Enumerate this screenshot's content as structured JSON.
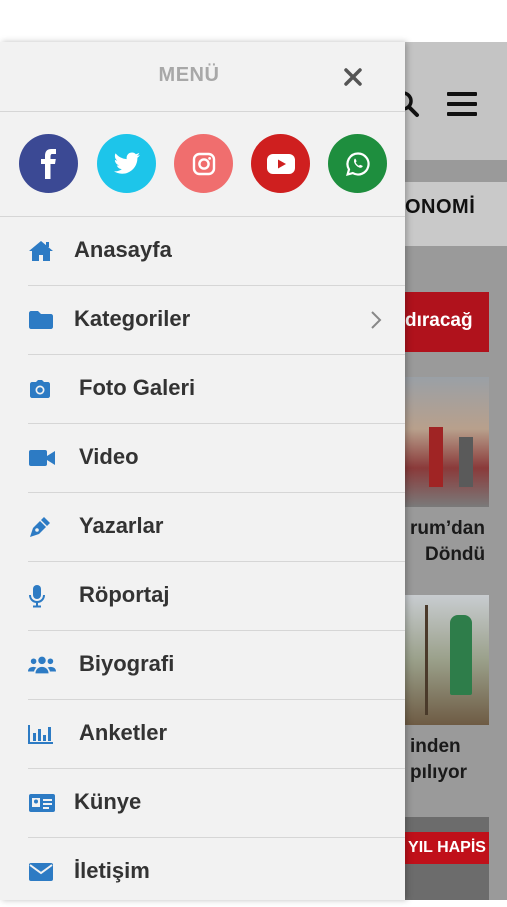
{
  "drawer": {
    "title": "MENÜ",
    "close_icon": "close-icon",
    "social": [
      {
        "name": "facebook",
        "icon": "facebook-icon",
        "color": "#3b4994"
      },
      {
        "name": "twitter",
        "icon": "twitter-icon",
        "color": "#1dc5ea"
      },
      {
        "name": "instagram",
        "icon": "instagram-icon",
        "color": "#f06e6e"
      },
      {
        "name": "youtube",
        "icon": "youtube-icon",
        "color": "#cf1f1f"
      },
      {
        "name": "whatsapp",
        "icon": "whatsapp-icon",
        "color": "#1e8e3e"
      }
    ],
    "menu": [
      {
        "label": "Anasayfa",
        "icon": "home-icon"
      },
      {
        "label": "Kategoriler",
        "icon": "folder-icon",
        "has_submenu": true
      },
      {
        "label": "Foto Galeri",
        "icon": "camera-icon"
      },
      {
        "label": "Video",
        "icon": "video-icon"
      },
      {
        "label": "Yazarlar",
        "icon": "pen-icon"
      },
      {
        "label": "Röportaj",
        "icon": "microphone-icon"
      },
      {
        "label": "Biyografi",
        "icon": "users-icon"
      },
      {
        "label": "Anketler",
        "icon": "chart-icon"
      },
      {
        "label": "Künye",
        "icon": "id-card-icon"
      },
      {
        "label": "İletişim",
        "icon": "envelope-icon"
      }
    ],
    "icon_color": "#2d7bc4"
  },
  "background_page": {
    "category_label": "ONOMİ",
    "banner_text": "dıracağ",
    "headline_1_line_1": "rum’dan",
    "headline_1_line_2": "Döndü",
    "headline_2_line_1": "inden",
    "headline_2_line_2": "pılıyor",
    "thumb_3_label": "YIL HAPİS"
  }
}
